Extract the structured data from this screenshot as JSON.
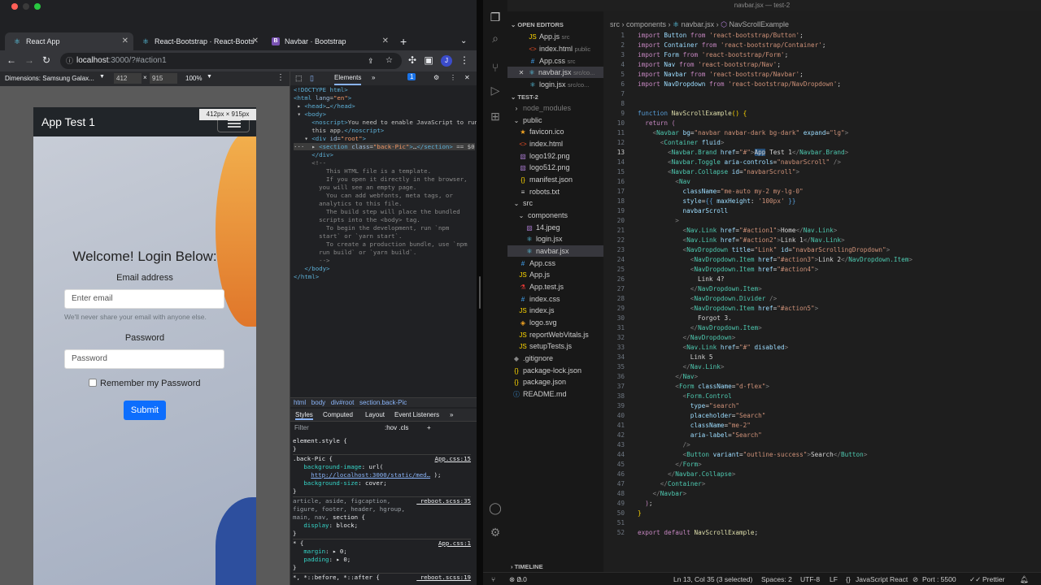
{
  "browser": {
    "tabs": [
      {
        "label": "React App",
        "active": true
      },
      {
        "label": "React-Bootstrap · React-Boots"
      },
      {
        "label": "Navbar · Bootstrap"
      }
    ],
    "url_host": "localhost",
    "url_rest": ":3000/?#action1",
    "device": "Dimensions: Samsung Galax...",
    "width": "412",
    "height": "915",
    "zoom": "100%",
    "size_badge": "412px × 915px"
  },
  "app": {
    "brand": "App Test 1",
    "login_title": "Welcome! Login Below:",
    "email_label": "Email address",
    "email_placeholder": "Enter email",
    "email_help": "We'll never share your email with anyone else.",
    "password_label": "Password",
    "password_placeholder": "Password",
    "remember": "Remember my Password",
    "submit": "Submit"
  },
  "devtools": {
    "elements_tab": "Elements",
    "issues": "1",
    "crumbs": [
      "html",
      "body",
      "div#root",
      "section.back-Pic"
    ],
    "styles_tabs": [
      "Styles",
      "Computed",
      "Layout",
      "Event Listeners"
    ],
    "filter": "Filter",
    "filter_tools": ":hov  .cls"
  },
  "vscode": {
    "title": "navbar.jsx — test-2",
    "breadcrumb": [
      "src",
      "components",
      "navbar.jsx",
      "NavScrollExample"
    ],
    "open_editors_label": "OPEN EDITORS",
    "project_label": "TEST-2",
    "timeline_label": "TIMELINE",
    "open_editors": [
      {
        "name": "App.js",
        "dir": "src"
      },
      {
        "name": "index.html",
        "dir": "public"
      },
      {
        "name": "App.css",
        "dir": "src"
      },
      {
        "name": "navbar.jsx",
        "dir": "src/co..."
      },
      {
        "name": "login.jsx",
        "dir": "src/co..."
      }
    ],
    "tree": [
      {
        "name": "node_modules"
      },
      {
        "name": "public"
      },
      {
        "name": "favicon.ico"
      },
      {
        "name": "index.html"
      },
      {
        "name": "logo192.png"
      },
      {
        "name": "logo512.png"
      },
      {
        "name": "manifest.json"
      },
      {
        "name": "robots.txt"
      },
      {
        "name": "src"
      },
      {
        "name": "components"
      },
      {
        "name": "14.jpeg"
      },
      {
        "name": "login.jsx"
      },
      {
        "name": "navbar.jsx"
      },
      {
        "name": "App.css"
      },
      {
        "name": "App.js"
      },
      {
        "name": "App.test.js"
      },
      {
        "name": "index.css"
      },
      {
        "name": "index.js"
      },
      {
        "name": "logo.svg"
      },
      {
        "name": "reportWebVitals.js"
      },
      {
        "name": "setupTests.js"
      },
      {
        "name": ".gitignore"
      },
      {
        "name": "package-lock.json"
      },
      {
        "name": "package.json"
      },
      {
        "name": "README.md"
      }
    ],
    "status": {
      "errors": "0",
      "warnings": "0",
      "position": "Ln 13, Col 35 (3 selected)",
      "spaces": "Spaces: 2",
      "encoding": "UTF-8",
      "eol": "LF",
      "language": "JavaScript React",
      "port": "Port : 5500",
      "formatter": "Prettier"
    }
  },
  "colors": {
    "navbar_dark": "#212529",
    "primary": "#0d6efd",
    "vscode_bg": "#1e1e1e"
  }
}
